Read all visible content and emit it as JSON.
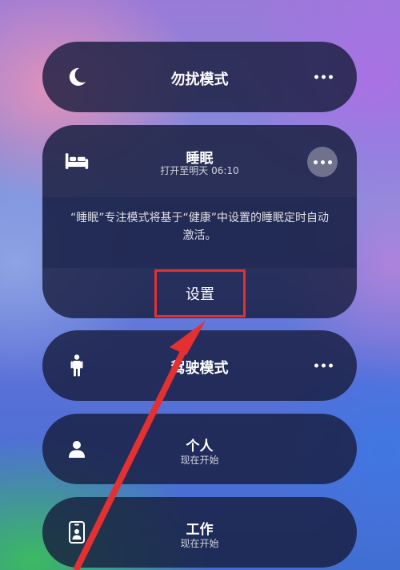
{
  "modes": {
    "dnd": {
      "title": "勿扰模式",
      "icon": "moon-icon"
    },
    "sleep": {
      "title": "睡眠",
      "subtitle": "打开至明天 06:10",
      "icon": "bed-icon",
      "description": "“睡眠”专注模式将基于“健康”中设置的睡眠定时自动激活。",
      "settings_label": "设置"
    },
    "driving": {
      "title": "驾驶模式",
      "icon": "person-standing-icon"
    },
    "personal": {
      "title": "个人",
      "subtitle": "现在开始",
      "icon": "person-icon"
    },
    "work": {
      "title": "工作",
      "subtitle": "现在开始",
      "icon": "id-badge-icon"
    }
  },
  "annotation": {
    "color": "#e33030"
  }
}
